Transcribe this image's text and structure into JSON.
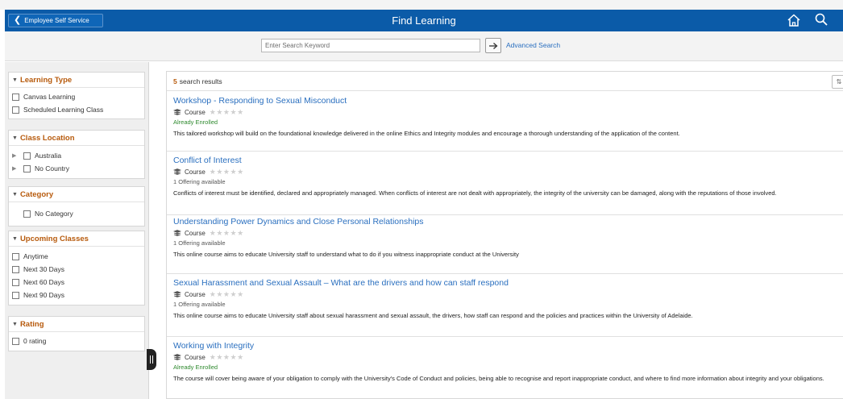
{
  "header": {
    "back_label": "Employee Self Service",
    "title": "Find Learning",
    "home_icon": "home-icon",
    "search_icon": "search-icon",
    "color": "#0b5ba8"
  },
  "search": {
    "placeholder": "Enter Search Keyword",
    "value": "",
    "advanced_label": "Advanced Search"
  },
  "facets": {
    "learning_type": {
      "title": "Learning Type",
      "options": [
        "Canvas Learning",
        "Scheduled Learning Class"
      ]
    },
    "class_location": {
      "title": "Class Location",
      "options": [
        "Australia",
        "No Country"
      ]
    },
    "category": {
      "title": "Category",
      "options": [
        "No Category"
      ]
    },
    "upcoming": {
      "title": "Upcoming Classes",
      "options": [
        "Anytime",
        "Next 30 Days",
        "Next 60 Days",
        "Next 90 Days"
      ]
    },
    "rating": {
      "title": "Rating",
      "options": [
        "0 rating"
      ]
    }
  },
  "results": {
    "count": "5",
    "count_label": "search results",
    "sort_icon": "sort-icon",
    "items": [
      {
        "title": "Workshop - Responding to Sexual Misconduct",
        "type": "Course",
        "stars": "★★★★★",
        "status": "Already Enrolled",
        "description": "This tailored workshop will build on the foundational knowledge delivered in the online Ethics and Integrity modules and encourage a thorough understanding of the application of the content."
      },
      {
        "title": "Conflict of Interest",
        "type": "Course",
        "stars": "★★★★★",
        "status": "1 Offering available",
        "description": "Conflicts of interest must be identified, declared and appropriately managed. When conflicts of interest are not dealt with appropriately, the integrity of the university can be damaged, along with the reputations of those involved."
      },
      {
        "title": "Understanding Power Dynamics and Close Personal Relationships",
        "type": "Course",
        "stars": "★★★★★",
        "status": "1 Offering available",
        "description": "This online course aims to educate University staff to understand what to do if you witness inappropriate conduct at the University"
      },
      {
        "title": "Sexual Harassment and Sexual Assault – What are the drivers and how can staff respond",
        "type": "Course",
        "stars": "★★★★★",
        "status": "1 Offering available",
        "description": "This online course aims to educate University staff about sexual harassment and sexual assault, the drivers, how staff can respond and the policies and practices within the University of Adelaide."
      },
      {
        "title": "Working with Integrity",
        "type": "Course",
        "stars": "★★★★★",
        "status": "Already Enrolled",
        "description": "The course will cover being aware of your obligation to comply with the University's Code of Conduct and policies, being able to recognise and report inappropriate conduct, and where to find more information about integrity and your obligations."
      }
    ]
  }
}
